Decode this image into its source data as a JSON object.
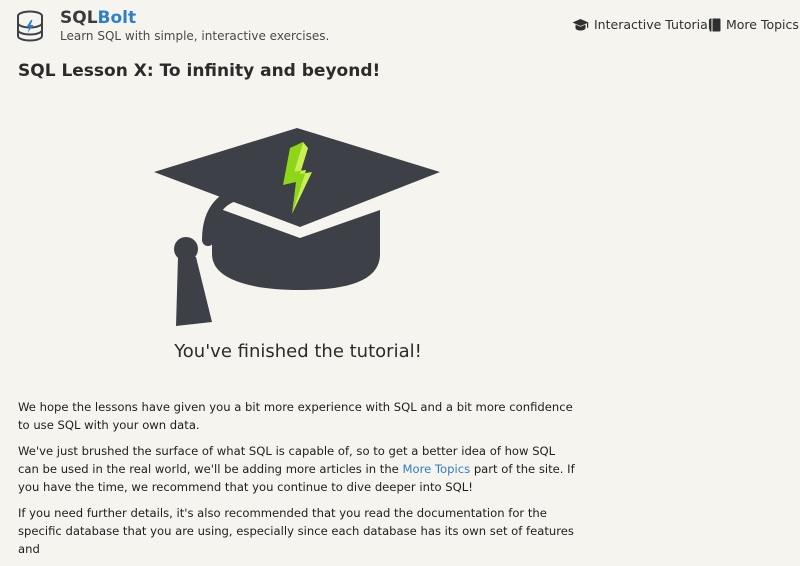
{
  "header": {
    "brand_prefix": "SQL",
    "brand_suffix": "Bolt",
    "tagline": "Learn SQL with simple, interactive exercises.",
    "nav": [
      {
        "label": "Interactive Tutorial",
        "icon": "graduation-cap-icon"
      },
      {
        "label": "More Topics",
        "icon": "book-icon"
      }
    ]
  },
  "lesson": {
    "title": "SQL Lesson X: To infinity and beyond!",
    "finished_caption": "You've finished the tutorial!",
    "paragraphs": [
      {
        "text": "We hope the lessons have given you a bit more experience with SQL and a bit more confidence to use SQL with your own data."
      },
      {
        "text_before": "We've just brushed the surface of what SQL is capable of, so to get a better idea of how SQL can be used in the real world, we'll be adding more articles in the ",
        "link": "More Topics",
        "text_after": " part of the site. If you have the time, we recommend that you continue to dive deeper into SQL!"
      },
      {
        "text": "If you need further details, it's also recommended that you read the documentation for the specific database that you are using, especially since each database has its own set of features and"
      }
    ]
  },
  "colors": {
    "background": "#f6f4ef",
    "accent": "#2f7fc7",
    "cap": "#3d4147",
    "bolt": "#8fd61b"
  }
}
